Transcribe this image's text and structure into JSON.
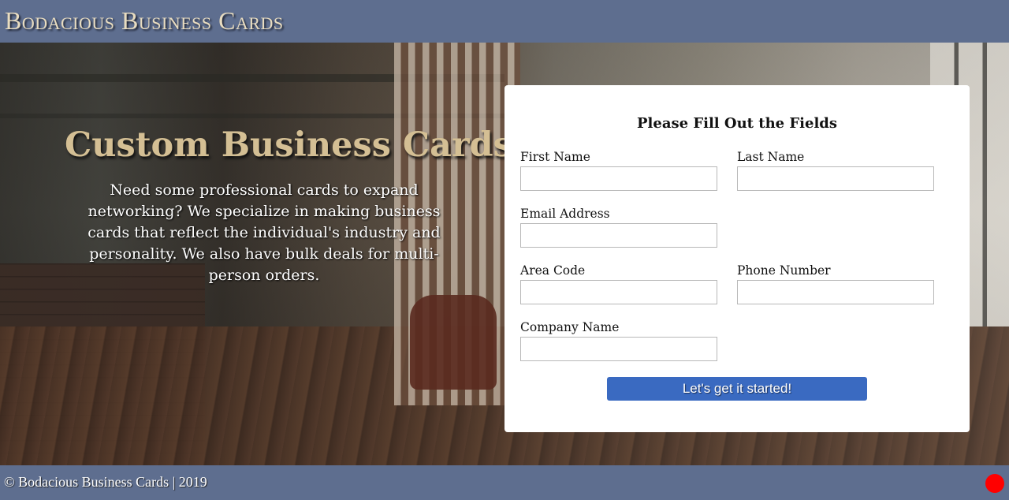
{
  "header": {
    "brand": "Bodacious Business Cards"
  },
  "hero": {
    "title": "Custom Business Cards",
    "text": "Need some professional cards to expand networking? We specialize in making business cards that reflect the individual's industry and personality. We also have bulk deals for multi-person orders."
  },
  "form": {
    "title": "Please Fill Out the Fields",
    "fields": {
      "first_name": {
        "label": "First Name",
        "value": "",
        "placeholder": ""
      },
      "last_name": {
        "label": "Last Name",
        "value": "",
        "placeholder": ""
      },
      "email": {
        "label": "Email Address",
        "value": "",
        "placeholder": ""
      },
      "area_code": {
        "label": "Area Code",
        "value": "",
        "placeholder": ""
      },
      "phone": {
        "label": "Phone Number",
        "value": "",
        "placeholder": ""
      },
      "company": {
        "label": "Company Name",
        "value": "",
        "placeholder": ""
      }
    },
    "submit_label": "Let's get it started!"
  },
  "footer": {
    "text": "© Bodacious Business Cards | 2019"
  },
  "colors": {
    "header_bg": "#5e6e8f",
    "title_gold": "#d4bf94",
    "button_blue": "#3a6ac1",
    "status_dot": "#ff0000"
  }
}
